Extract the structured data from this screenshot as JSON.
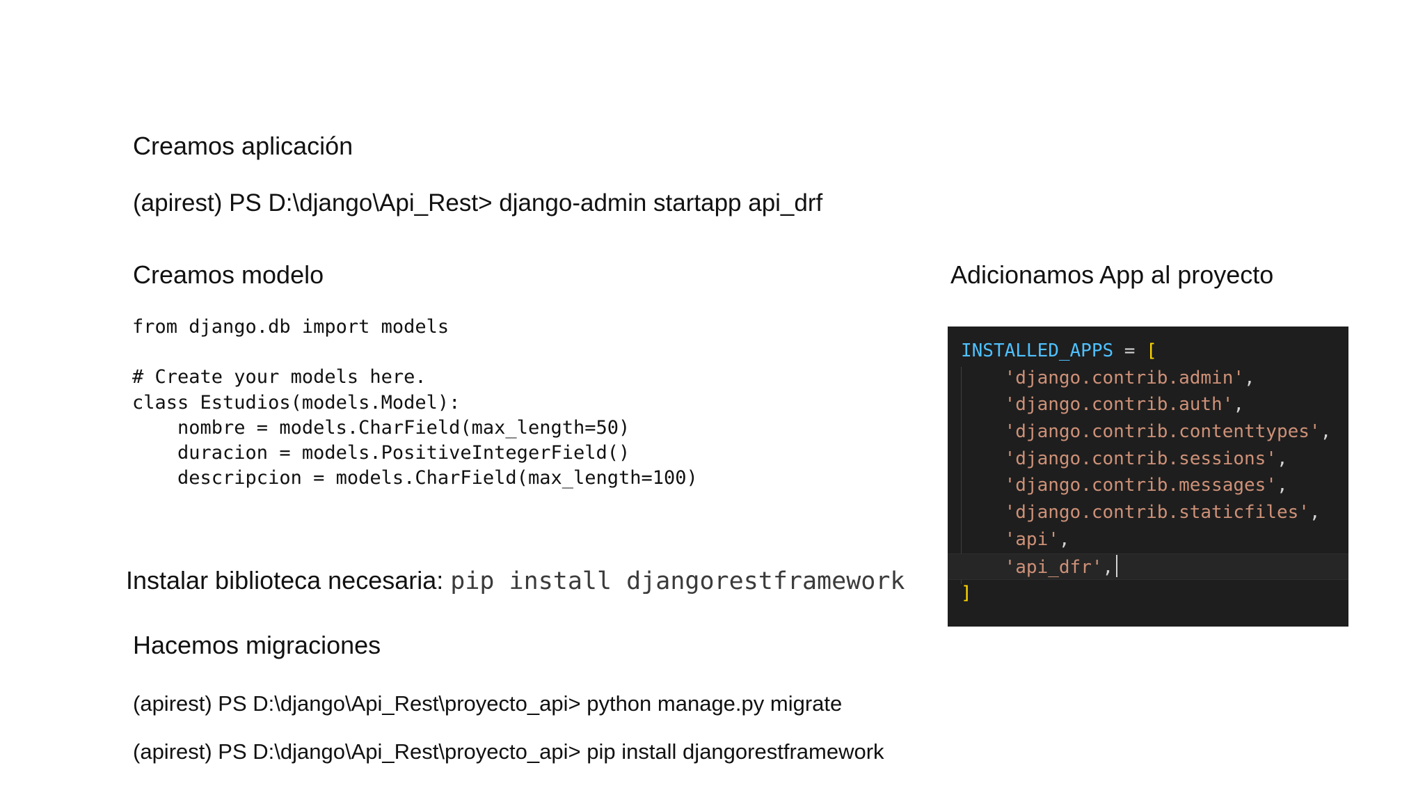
{
  "sections": {
    "create_app": {
      "title": "Creamos aplicación",
      "command": "(apirest) PS D:\\django\\Api_Rest> django-admin startapp api_drf"
    },
    "create_model": {
      "title": "Creamos modelo",
      "code_lines": [
        "from django.db import models",
        "",
        "# Create your models here.",
        "class Estudios(models.Model):",
        "    nombre = models.CharField(max_length=50)",
        "    duracion = models.PositiveIntegerField()",
        "    descripcion = models.CharField(max_length=100)"
      ]
    },
    "install_library": {
      "label": "Instalar biblioteca necesaria: ",
      "command": "pip install djangorestframework"
    },
    "migrations": {
      "title": "Hacemos migraciones",
      "commands": [
        "(apirest) PS D:\\django\\Api_Rest\\proyecto_api> python manage.py migrate",
        "(apirest) PS D:\\django\\Api_Rest\\proyecto_api> pip install djangorestframework"
      ]
    },
    "add_app": {
      "title": "Adicionamos App al proyecto",
      "editor": {
        "variable": "INSTALLED_APPS",
        "assign": " = ",
        "open_bracket": "[",
        "close_bracket": "]",
        "apps": [
          "'django.contrib.admin'",
          "'django.contrib.auth'",
          "'django.contrib.contenttypes'",
          "'django.contrib.sessions'",
          "'django.contrib.messages'",
          "'django.contrib.staticfiles'",
          "'api'",
          "'api_dfr'"
        ],
        "comma": ",",
        "indent": "    "
      }
    }
  },
  "colors": {
    "editor_background": "#1e1e1e",
    "variable": "#4fc1ff",
    "string": "#ce9178",
    "bracket": "#ffd700",
    "text": "#d4d4d4"
  }
}
